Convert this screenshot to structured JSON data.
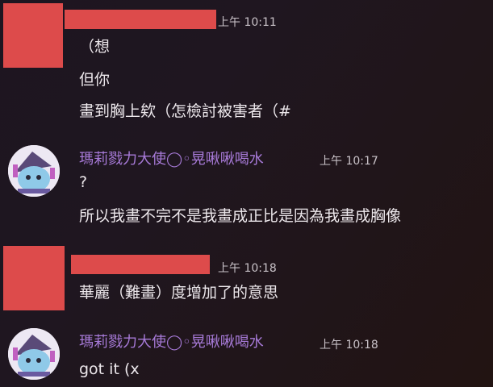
{
  "messages": [
    {
      "author": "",
      "timestamp": "上午 10:11",
      "lines": [
        "（想",
        "但你",
        "畫到胸上欸（怎檢討被害者（#"
      ]
    },
    {
      "author": "瑪莉戮力大使◯◦晃啾啾喝水",
      "timestamp": "上午 10:17",
      "lines": [
        "?",
        "所以我畫不完不是我畫成正比是因為我畫成胸像"
      ]
    },
    {
      "author": "",
      "timestamp": "上午 10:18",
      "lines": [
        "華麗（難畫）度增加了的意思"
      ]
    },
    {
      "author": "瑪莉戮力大使◯◦晃啾啾喝水",
      "timestamp": "上午 10:18",
      "lines": [
        "got it (x"
      ]
    }
  ],
  "colors": {
    "redaction": "#dd4b4b",
    "username": "#a77ad8",
    "background": "#1f1620"
  }
}
